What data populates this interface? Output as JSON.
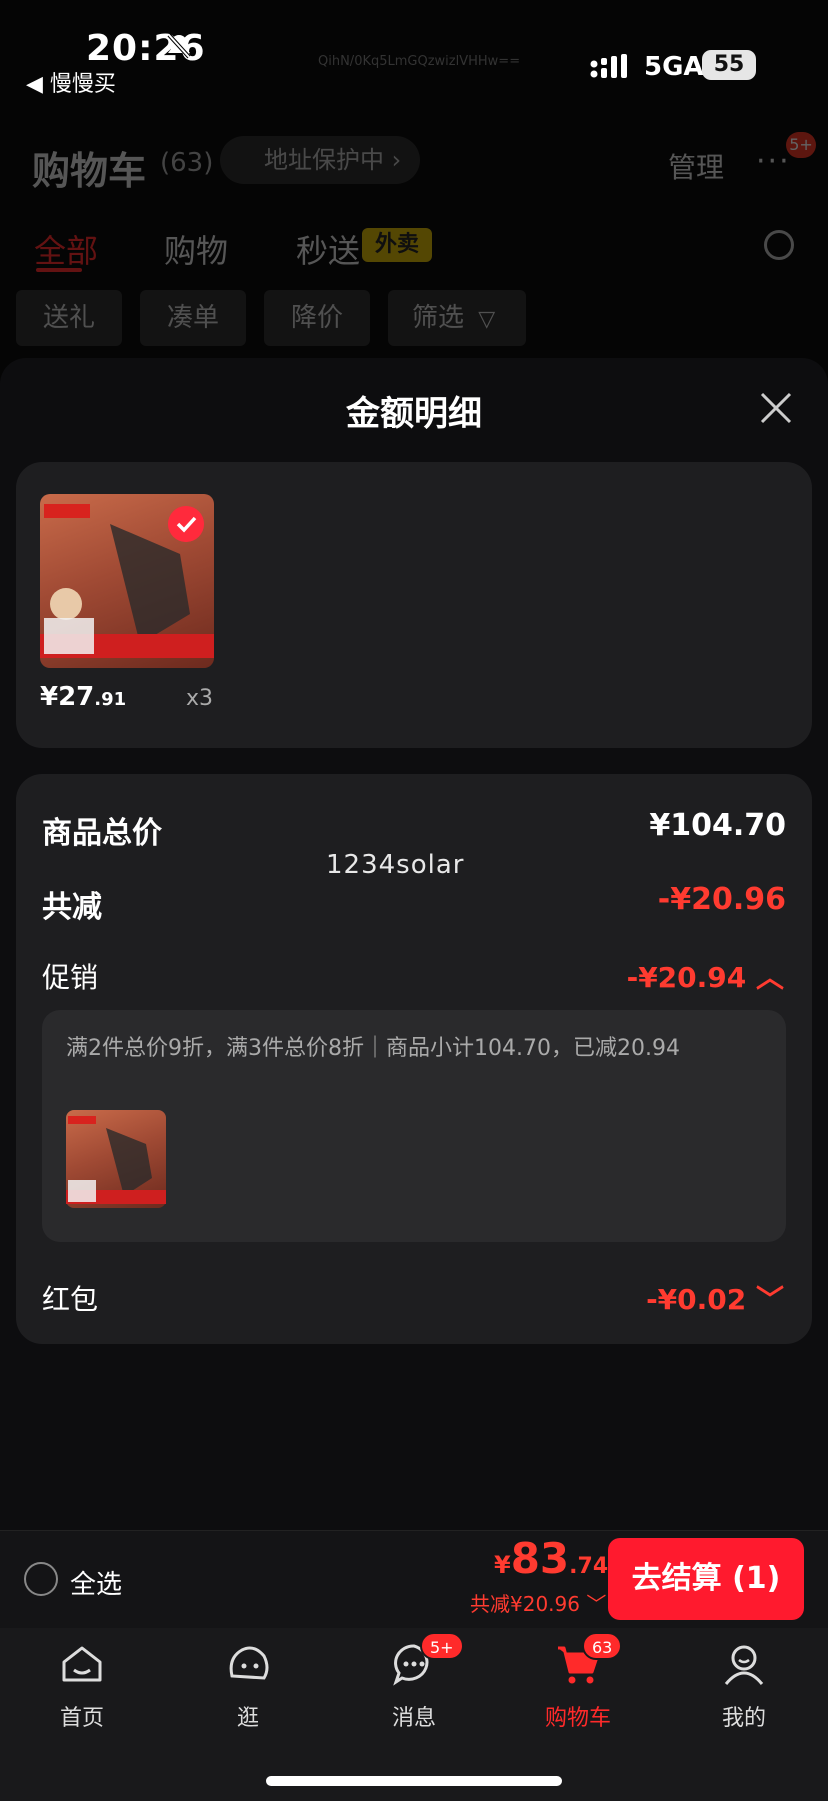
{
  "status_bar": {
    "time": "20:26",
    "back_app": "◀ 慢慢买",
    "watermark": "QihN/0Kq5LmGQzwizlVHHw==",
    "network": "5GA",
    "battery": "55"
  },
  "cart": {
    "title": "购物车",
    "count": "(63)",
    "address_protect": "地址保护中 ›",
    "manage": "管理",
    "more": "···",
    "more_badge": "5+",
    "tabs": [
      "全部",
      "购物",
      "秒送"
    ],
    "waimai_badge": "外卖",
    "filters": [
      "送礼",
      "凑单",
      "降价",
      "筛选"
    ]
  },
  "sheet": {
    "title": "金额明细",
    "product": {
      "price_int": "¥27",
      "price_dec": ".91",
      "quantity": "x3"
    },
    "summary": {
      "total_label": "商品总价",
      "total_value": "¥104.70",
      "reduce_label": "共减",
      "reduce_value": "-¥20.96",
      "watermark": "1234solar",
      "promo_label": "促销",
      "promo_value": "-¥20.94 ︿",
      "promo_desc": "满2件总价9折，满3件总价8折｜商品小计104.70，已减20.94",
      "hongbao_label": "红包",
      "hongbao_value": "-¥0.02 ﹀"
    }
  },
  "checkout": {
    "select_all": "全选",
    "total_cur": "¥",
    "total_int": "83",
    "total_dec": ".74",
    "discount": "共减¥20.96 ﹀",
    "pay_button": "去结算 (1)"
  },
  "tabbar": {
    "items": [
      {
        "label": "首页"
      },
      {
        "label": "逛"
      },
      {
        "label": "消息",
        "badge": "5+"
      },
      {
        "label": "购物车",
        "badge": "63"
      },
      {
        "label": "我的"
      }
    ]
  },
  "colors": {
    "accent": "#ff2a2a",
    "pay": "#ff1a2e",
    "waimai": "#d8b400"
  }
}
